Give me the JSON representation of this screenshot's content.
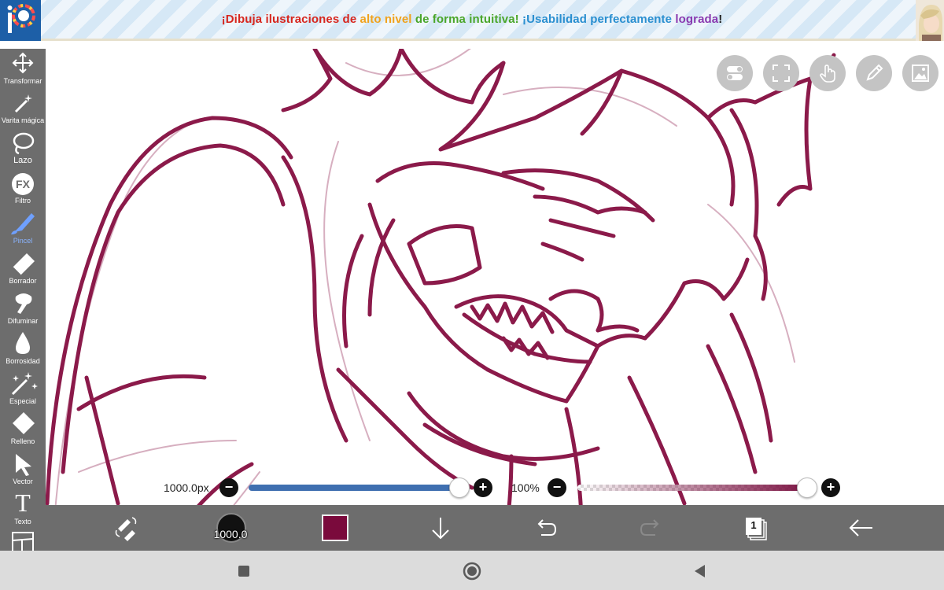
{
  "banner": {
    "segments": [
      {
        "text": "¡Dibuja ilustraciones de ",
        "color": "#d7261e"
      },
      {
        "text": "alto nivel ",
        "color": "#f0a21c"
      },
      {
        "text": "de forma intuitiva! ",
        "color": "#4aa62a"
      },
      {
        "text": "¡Usabilidad perfectamente ",
        "color": "#2a8fd0"
      },
      {
        "text": "lograda",
        "color": "#8a3ab0"
      },
      {
        "text": "!",
        "color": "#222222"
      }
    ]
  },
  "toolbar": {
    "tools": [
      {
        "label": "Transformar",
        "icon": "move-icon"
      },
      {
        "label": "Varita mágica",
        "icon": "magic-wand-icon"
      },
      {
        "label": "Lazo",
        "icon": "lasso-icon"
      },
      {
        "label": "Filtro",
        "icon": "fx-icon",
        "icon_text": "FX"
      },
      {
        "label": "Pincel",
        "icon": "brush-icon",
        "active": true
      },
      {
        "label": "Borrador",
        "icon": "eraser-icon"
      },
      {
        "label": "Difuminar",
        "icon": "smudge-icon"
      },
      {
        "label": "Borrosidad",
        "icon": "blur-drop-icon"
      },
      {
        "label": "Especial",
        "icon": "special-brush-icon"
      },
      {
        "label": "Relleno",
        "icon": "fill-bucket-icon"
      },
      {
        "label": "Vector",
        "icon": "vector-arrow-icon"
      },
      {
        "label": "Texto",
        "icon": "text-icon",
        "icon_text": "T"
      }
    ]
  },
  "sliders": {
    "brush_size": {
      "label": "1000.0px",
      "value_fraction": 1.0,
      "track_color": "#3f6fb0"
    },
    "opacity": {
      "label": "100%",
      "value_fraction": 1.0,
      "track_color": "#7a1040"
    },
    "minus": "−",
    "plus": "+"
  },
  "bottom_bar": {
    "brush_size_label": "1000.0",
    "current_color": "#7a0a3c",
    "layer_count": "1"
  },
  "colors": {
    "line_art": "#8b1a4a",
    "toolbar_bg": "#6d6d6d",
    "active_tool": "#8ab4ff"
  }
}
